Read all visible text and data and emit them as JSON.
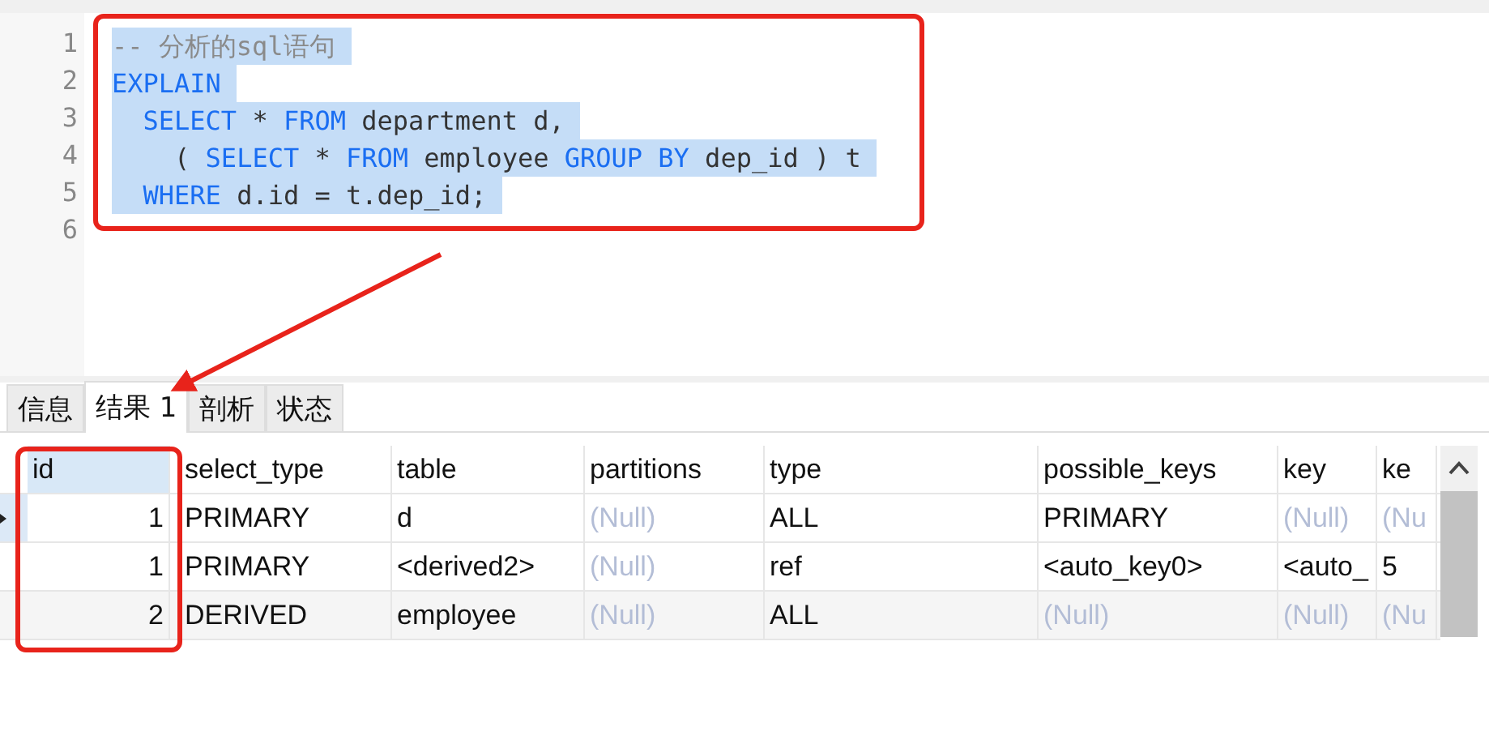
{
  "editor": {
    "lines": [
      {
        "number": "1",
        "selected": true,
        "tokens": [
          {
            "kind": "comment",
            "text": "-- 分析的sql语句"
          }
        ]
      },
      {
        "number": "2",
        "selected": true,
        "tokens": [
          {
            "kind": "keyword",
            "text": "EXPLAIN"
          }
        ]
      },
      {
        "number": "3",
        "selected": true,
        "tokens": [
          {
            "kind": "keyword",
            "text": "  SELECT"
          },
          {
            "kind": "plain",
            "text": " * "
          },
          {
            "kind": "keyword",
            "text": "FROM"
          },
          {
            "kind": "plain",
            "text": " department d,"
          }
        ]
      },
      {
        "number": "4",
        "selected": true,
        "tokens": [
          {
            "kind": "plain",
            "text": "    ( "
          },
          {
            "kind": "keyword",
            "text": "SELECT"
          },
          {
            "kind": "plain",
            "text": " * "
          },
          {
            "kind": "keyword",
            "text": "FROM"
          },
          {
            "kind": "plain",
            "text": " employee "
          },
          {
            "kind": "keyword",
            "text": "GROUP BY"
          },
          {
            "kind": "plain",
            "text": " dep_id ) t"
          }
        ]
      },
      {
        "number": "5",
        "selected": true,
        "tokens": [
          {
            "kind": "keyword",
            "text": "  WHERE"
          },
          {
            "kind": "plain",
            "text": " d.id = t.dep_id;"
          }
        ]
      },
      {
        "number": "6"
      }
    ]
  },
  "tabs": [
    {
      "label": "信息",
      "selected": false
    },
    {
      "label": "结果 1",
      "selected": true
    },
    {
      "label": "剖析",
      "selected": false
    },
    {
      "label": "状态",
      "selected": false
    }
  ],
  "table": {
    "columns": [
      {
        "label": "id",
        "selected": true
      },
      {
        "label": "select_type",
        "selected": false
      },
      {
        "label": "table",
        "selected": false
      },
      {
        "label": "partitions",
        "selected": false
      },
      {
        "label": "type",
        "selected": false
      },
      {
        "label": "possible_keys",
        "selected": false
      },
      {
        "label": "key",
        "selected": false
      },
      {
        "label": "ke",
        "selected": false
      }
    ],
    "rows": [
      {
        "current": true,
        "cells": [
          {
            "text": "1",
            "null": false
          },
          {
            "text": "PRIMARY",
            "null": false
          },
          {
            "text": "d",
            "null": false
          },
          {
            "text": "(Null)",
            "null": true
          },
          {
            "text": "ALL",
            "null": false
          },
          {
            "text": "PRIMARY",
            "null": false
          },
          {
            "text": "(Null)",
            "null": true
          },
          {
            "text": "(Nu",
            "null": true
          }
        ]
      },
      {
        "current": false,
        "cells": [
          {
            "text": "1",
            "null": false
          },
          {
            "text": "PRIMARY",
            "null": false
          },
          {
            "text": "<derived2>",
            "null": false
          },
          {
            "text": "(Null)",
            "null": true
          },
          {
            "text": "ref",
            "null": false
          },
          {
            "text": "<auto_key0>",
            "null": false
          },
          {
            "text": "<auto_",
            "null": false
          },
          {
            "text": "5",
            "null": false
          }
        ]
      },
      {
        "current": false,
        "cells": [
          {
            "text": "2",
            "null": false
          },
          {
            "text": "DERIVED",
            "null": false
          },
          {
            "text": "employee",
            "null": false
          },
          {
            "text": "(Null)",
            "null": true
          },
          {
            "text": "ALL",
            "null": false
          },
          {
            "text": "(Null)",
            "null": true
          },
          {
            "text": "(Null)",
            "null": true
          },
          {
            "text": "(Nu",
            "null": true
          }
        ]
      }
    ]
  }
}
